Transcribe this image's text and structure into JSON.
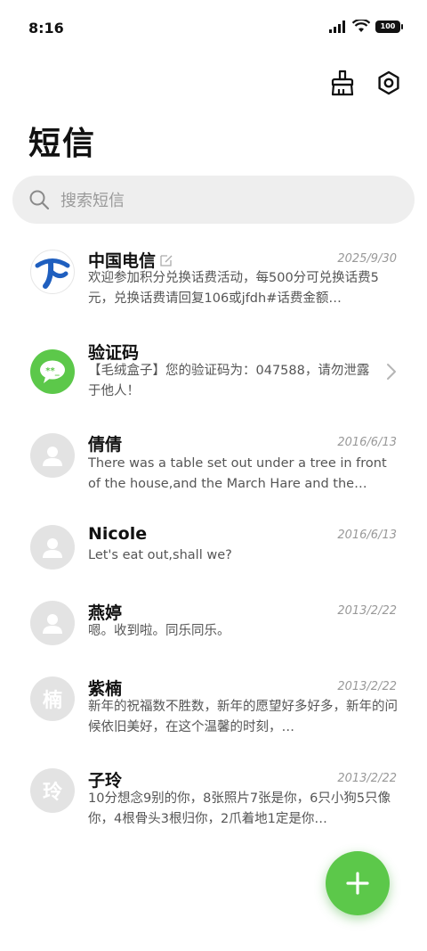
{
  "status_bar": {
    "time": "8:16",
    "battery": "100"
  },
  "header": {
    "title": "短信"
  },
  "search": {
    "placeholder": "搜索短信"
  },
  "conversations": [
    {
      "name": "中国电信",
      "date": "2025/9/30",
      "preview": "欢迎参加积分兑换话费活动，每500分可兑换话费5元，兑换话费请回复106或jfdh#话费金额…"
    },
    {
      "name": "验证码",
      "date": "",
      "preview": "【毛绒盒子】您的验证码为：047588，请勿泄露于他人！"
    },
    {
      "name": "倩倩",
      "date": "2016/6/13",
      "preview": "There was a table set out under a tree in front of the house,and the March Hare and the Hatte…"
    },
    {
      "name": "Nicole",
      "date": "2016/6/13",
      "preview": "Let's eat out,shall we?"
    },
    {
      "name": "燕婷",
      "date": "2013/2/22",
      "preview": "嗯。收到啦。同乐同乐。"
    },
    {
      "name": "紫楠",
      "avatar_char": "楠",
      "date": "2013/2/22",
      "preview": "新年的祝福数不胜数，新年的愿望好多好多，新年的问候依旧美好，在这个温馨的时刻，…"
    },
    {
      "name": "子玲",
      "avatar_char": "玲",
      "date": "2013/2/22",
      "preview": "10分想念9别的你，8张照片7张是你，6只小狗5只像你，4根骨头3根归你，2爪着地1定是你…"
    }
  ],
  "colors": {
    "accent": "#5cc84a",
    "telecom_blue": "#1f5fbf"
  }
}
